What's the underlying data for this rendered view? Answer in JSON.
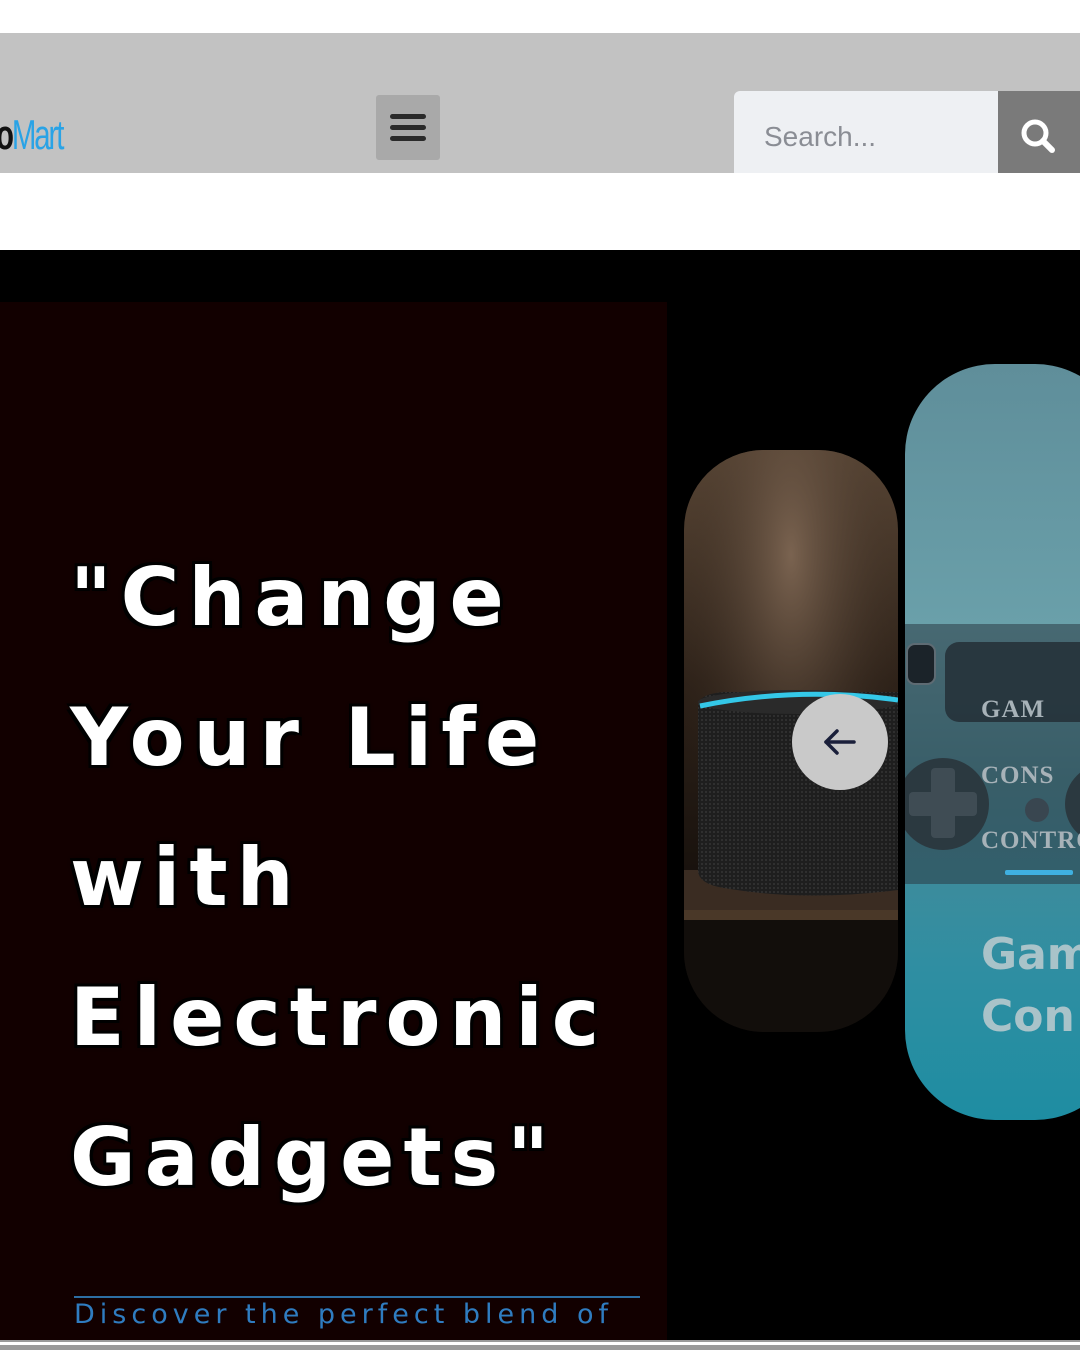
{
  "header": {
    "logo_part1": "o",
    "logo_part2": "Mart",
    "menu_icon": "hamburger-menu-icon",
    "search": {
      "placeholder": "Search...",
      "icon": "search-icon"
    }
  },
  "hero": {
    "headline": "\"Change\nYour Life\nwith\nElectronic\nGadgets\"",
    "subtext": "Discover the perfect blend of",
    "carousel": {
      "prev_icon": "arrow-left-icon",
      "slides": [
        {
          "image": "smart-speaker-image"
        },
        {
          "image": "game-controller-image",
          "labels": [
            "GAM",
            "CONS",
            "CONTRO"
          ],
          "title": "Gam\nCon"
        }
      ]
    }
  },
  "colors": {
    "header_bg": "#c2c2c2",
    "logo_accent": "#29a3e6",
    "hero_bg": "#000000",
    "hero_panel": "#120000",
    "subtext": "#2f7cc0"
  }
}
